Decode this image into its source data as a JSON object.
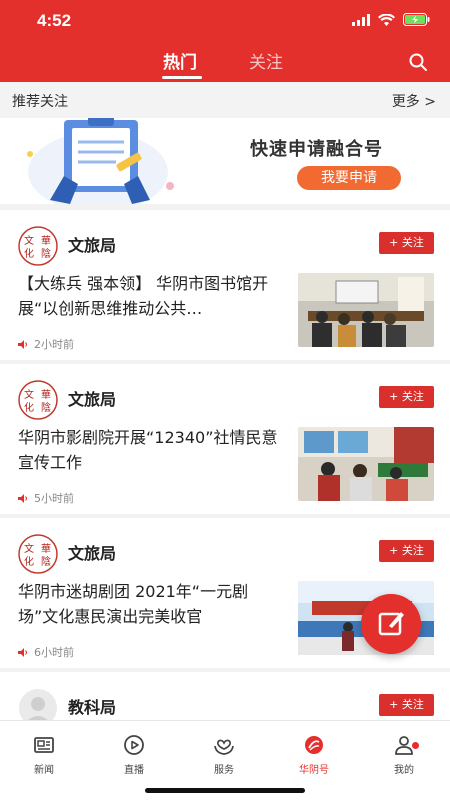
{
  "status": {
    "time": "4:52"
  },
  "header": {
    "tabs": [
      {
        "label": "热门",
        "active": true
      },
      {
        "label": "关注",
        "active": false
      }
    ]
  },
  "recommend": {
    "title": "推荐关注",
    "more": "更多 >"
  },
  "banner": {
    "title": "快速申请融合号",
    "button": "我要申请"
  },
  "feed": [
    {
      "author": "文旅局",
      "follow": "+ 关注",
      "headline": "【大练兵 强本领】 华阴市图书馆开展“以创新思维推动公共…",
      "time": "2小时前"
    },
    {
      "author": "文旅局",
      "follow": "+ 关注",
      "headline": "华阴市影剧院开展“12340”社情民意宣传工作",
      "time": "5小时前"
    },
    {
      "author": "文旅局",
      "follow": "+ 关注",
      "headline": "华阴市迷胡剧团 2021年“一元剧场”文化惠民演出完美收官",
      "time": "6小时前"
    },
    {
      "author": "教科局",
      "follow": "+ 关注"
    }
  ],
  "avatar_text": "文化華陰",
  "bottom_nav": [
    {
      "label": "新闻",
      "icon": "news-icon",
      "active": false
    },
    {
      "label": "直播",
      "icon": "live-icon",
      "active": false
    },
    {
      "label": "服务",
      "icon": "service-icon",
      "active": false
    },
    {
      "label": "华阴号",
      "icon": "huayin-icon",
      "active": true
    },
    {
      "label": "我的",
      "icon": "profile-icon",
      "active": false
    }
  ],
  "colors": {
    "brand": "#e4302d",
    "banner_button": "#f06a32"
  }
}
